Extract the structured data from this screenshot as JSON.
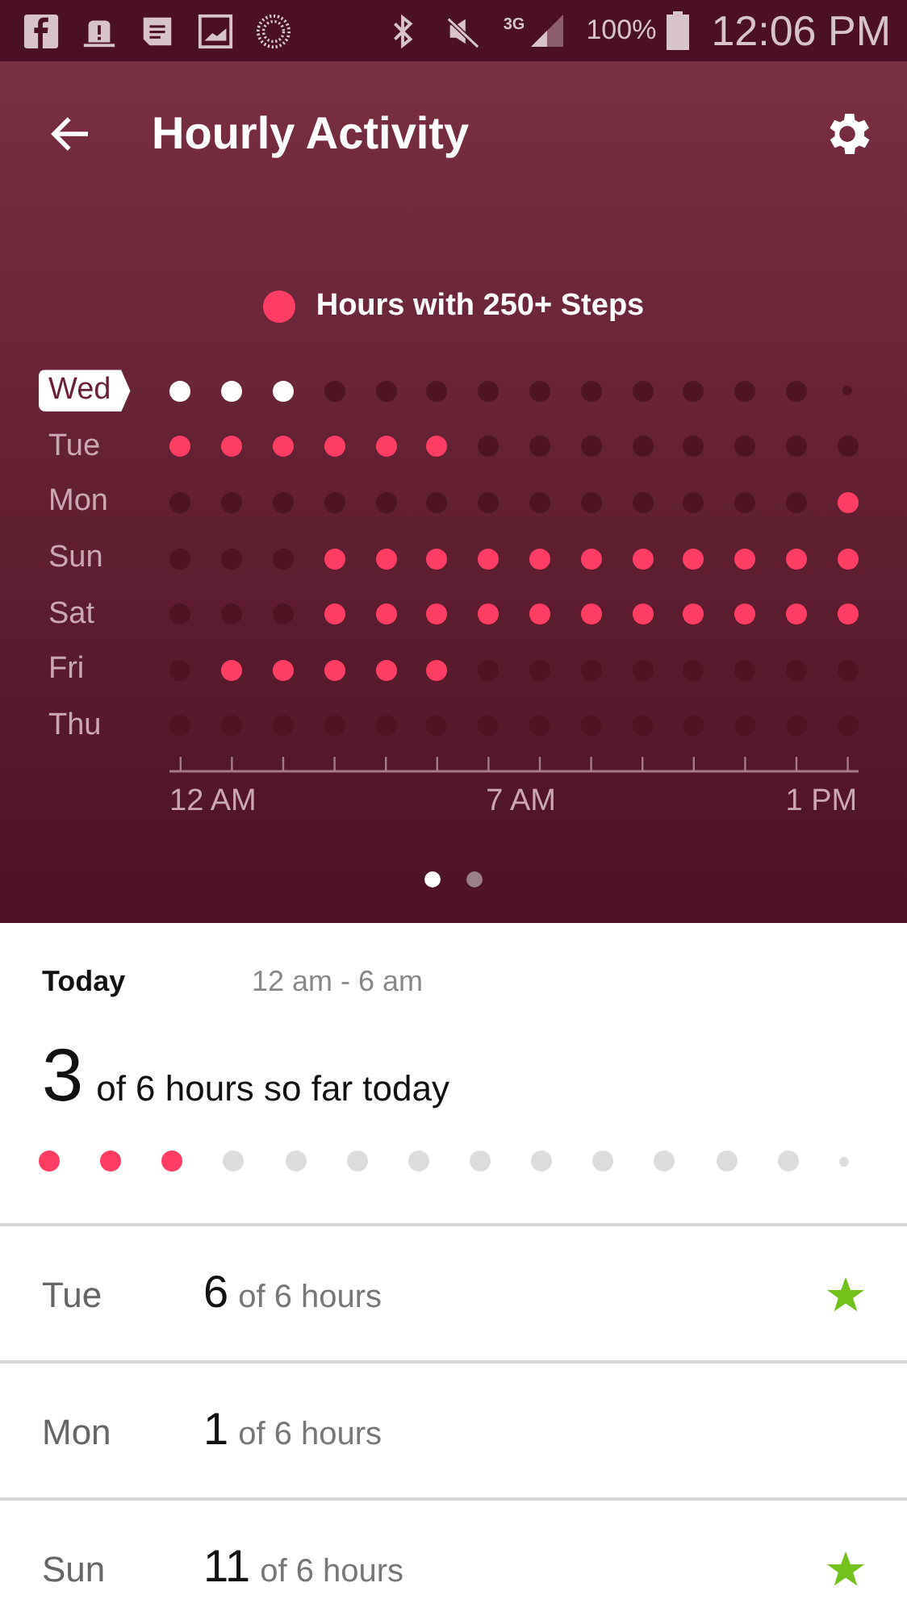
{
  "status_bar": {
    "network": "3G",
    "battery": "100%",
    "time": "12:06 PM"
  },
  "header": {
    "title": "Hourly Activity"
  },
  "legend": {
    "label": "Hours with 250+ Steps"
  },
  "grid": {
    "rows": [
      {
        "day": "Wed",
        "selected": true,
        "in_progress": true,
        "hours": [
          true,
          true,
          true,
          false,
          false,
          false,
          false,
          false,
          false,
          false,
          false,
          false,
          false
        ]
      },
      {
        "day": "Tue",
        "selected": false,
        "in_progress": false,
        "hours": [
          true,
          true,
          true,
          true,
          true,
          true,
          false,
          false,
          false,
          false,
          false,
          false,
          false,
          false
        ]
      },
      {
        "day": "Mon",
        "selected": false,
        "in_progress": false,
        "hours": [
          false,
          false,
          false,
          false,
          false,
          false,
          false,
          false,
          false,
          false,
          false,
          false,
          false,
          true
        ]
      },
      {
        "day": "Sun",
        "selected": false,
        "in_progress": false,
        "hours": [
          false,
          false,
          false,
          true,
          true,
          true,
          true,
          true,
          true,
          true,
          true,
          true,
          true,
          true
        ]
      },
      {
        "day": "Sat",
        "selected": false,
        "in_progress": false,
        "hours": [
          false,
          false,
          false,
          true,
          true,
          true,
          true,
          true,
          true,
          true,
          true,
          true,
          true,
          true
        ]
      },
      {
        "day": "Fri",
        "selected": false,
        "in_progress": false,
        "hours": [
          false,
          true,
          true,
          true,
          true,
          true,
          false,
          false,
          false,
          false,
          false,
          false,
          false,
          false
        ]
      },
      {
        "day": "Thu",
        "selected": false,
        "in_progress": false,
        "hours": [
          false,
          false,
          false,
          false,
          false,
          false,
          false,
          false,
          false,
          false,
          false,
          false,
          false,
          false
        ]
      }
    ],
    "axis_labels": [
      "12 AM",
      "7 AM",
      "1 PM"
    ]
  },
  "pager": [
    {
      "selected": true
    },
    {
      "selected": false
    }
  ],
  "today": {
    "label": "Today",
    "range": "12 am - 6 am",
    "count": "3",
    "summary": "of 6 hours so far today",
    "in_progress": true,
    "hours": [
      true,
      true,
      true,
      false,
      false,
      false,
      false,
      false,
      false,
      false,
      false,
      false,
      false
    ]
  },
  "days": [
    {
      "day": "Tue",
      "count": "6",
      "summary": "of 6 hours",
      "star": true
    },
    {
      "day": "Mon",
      "count": "1",
      "summary": "of 6 hours",
      "star": false
    },
    {
      "day": "Sun",
      "count": "11",
      "summary": "of 6 hours",
      "star": true
    }
  ]
}
